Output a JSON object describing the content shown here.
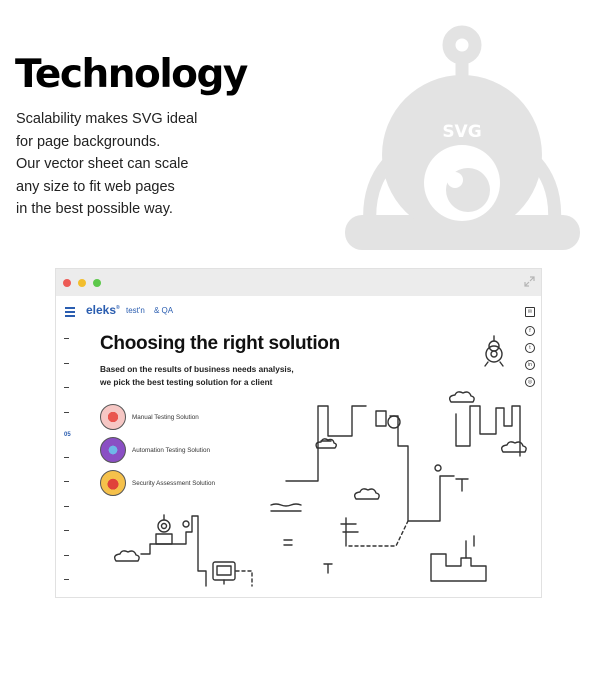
{
  "hero": {
    "title": "Technology",
    "lines": [
      "Scalability makes SVG ideal",
      "for page backgrounds.",
      "Our vector sheet can scale",
      "any size to fit web pages",
      "in the best possible way."
    ],
    "badge": "SVG"
  },
  "browser": {
    "logo": "eleks",
    "logo_sup": "®",
    "logo_tag": "test'n",
    "logo_tag2": "& QA",
    "heading": "Choosing the right solution",
    "subtitle": [
      "Based on the results of business needs analysis,",
      "we pick the best testing solution for a client"
    ],
    "nav_active": "05",
    "solutions": [
      {
        "label": "Manual Testing Solution",
        "color": "#e9564f"
      },
      {
        "label": "Automation Testing Solution",
        "color": "#8a4fc4"
      },
      {
        "label": "Security Assessment Solution",
        "color": "#e0413a"
      }
    ],
    "social": [
      "mail-icon",
      "facebook-icon",
      "twitter-icon",
      "linkedin-icon",
      "dribbble-icon"
    ]
  },
  "colors": {
    "accent": "#2a5db0",
    "mascot": "#e6e6e6",
    "window_bar": "#ececec"
  }
}
